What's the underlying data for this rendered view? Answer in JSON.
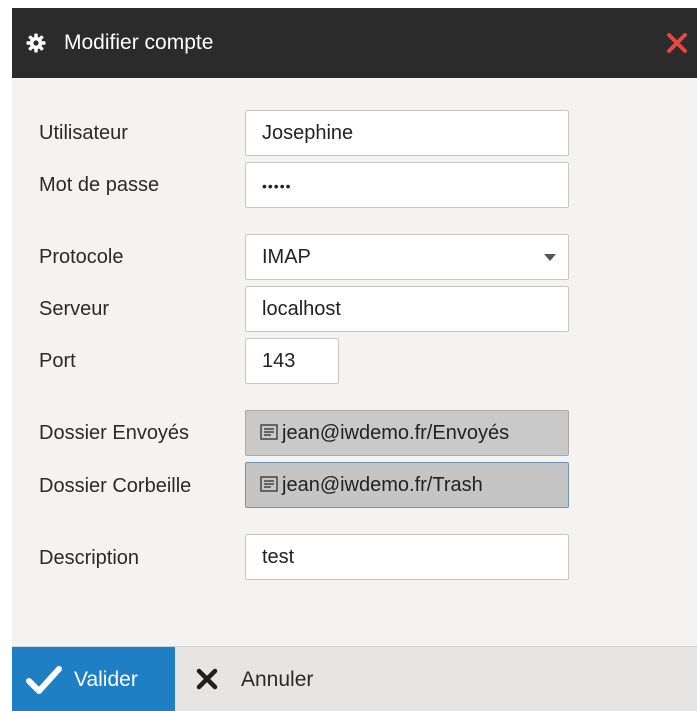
{
  "dialog": {
    "title": "Modifier compte",
    "title_icon": "gear-icon",
    "close_icon": "close-icon",
    "close_color": "#e8473f"
  },
  "form": {
    "user": {
      "label": "Utilisateur",
      "value": "Josephine"
    },
    "password": {
      "label": "Mot de passe",
      "value": "•••••"
    },
    "protocol": {
      "label": "Protocole",
      "value": "IMAP"
    },
    "server": {
      "label": "Serveur",
      "value": "localhost"
    },
    "port": {
      "label": "Port",
      "value": "143"
    },
    "sent_folder": {
      "label": "Dossier Envoyés",
      "value": "jean@iwdemo.fr/Envoyés"
    },
    "trash_folder": {
      "label": "Dossier Corbeille",
      "value": "jean@iwdemo.fr/Trash"
    },
    "description": {
      "label": "Description",
      "value": "test"
    }
  },
  "footer": {
    "validate_label": "Valider",
    "cancel_label": "Annuler",
    "validate_color": "#1f7fc4"
  }
}
